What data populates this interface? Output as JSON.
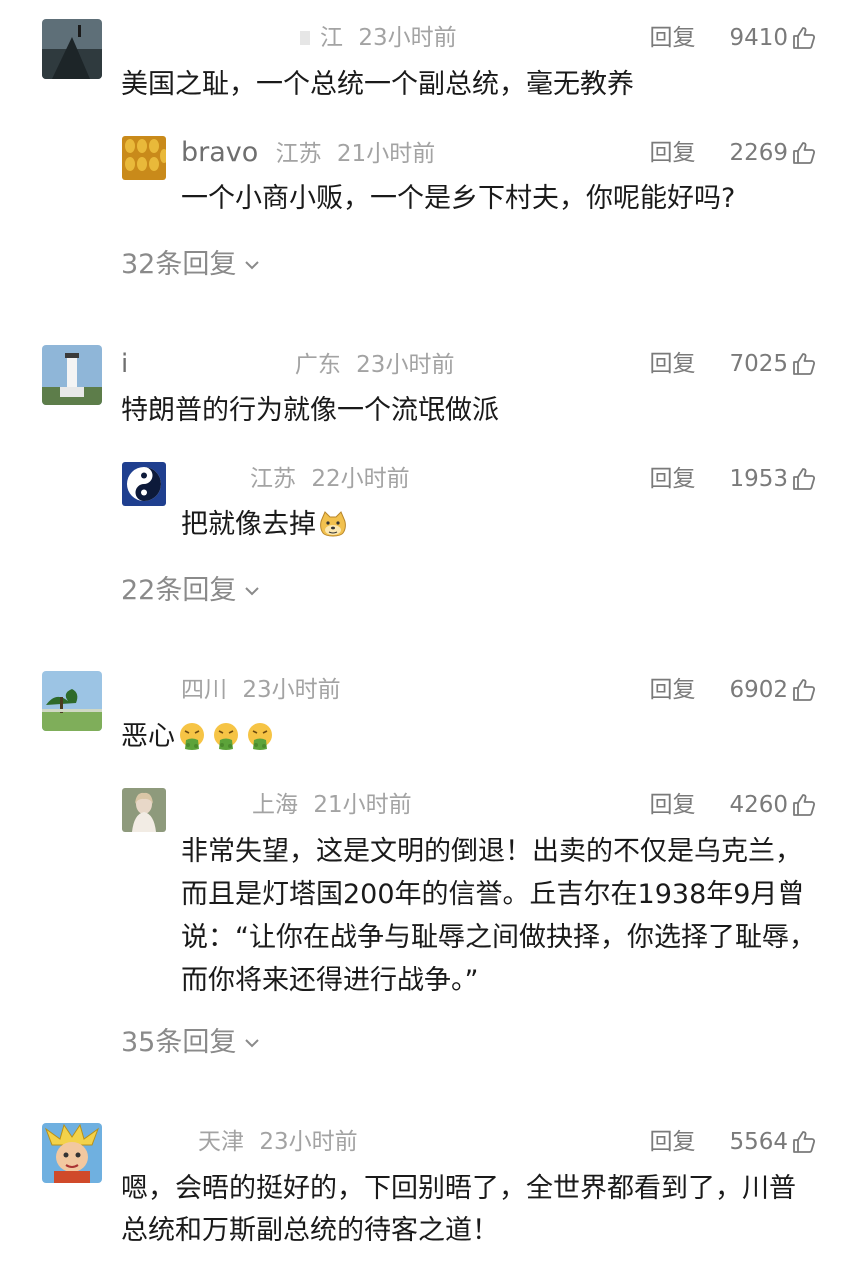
{
  "comments": [
    {
      "location": "江",
      "time": "23小时前",
      "reply_label": "回复",
      "likes": "9410",
      "text": "美国之耻，一个总统一个副总统，毫无教养",
      "reply": {
        "username": "bravo",
        "location": "江苏",
        "time": "21小时前",
        "reply_label": "回复",
        "likes": "2269",
        "text": "一个小商小贩，一个是乡下村夫，你呢能好吗?"
      },
      "more_replies": "32条回复"
    },
    {
      "name_fragment": "i",
      "location": "广东",
      "time": "23小时前",
      "reply_label": "回复",
      "likes": "7025",
      "text": "特朗普的行为就像一个流氓做派",
      "reply": {
        "location": "江苏",
        "time": "22小时前",
        "reply_label": "回复",
        "likes": "1953",
        "text": "把就像去掉"
      },
      "more_replies": "22条回复"
    },
    {
      "location": "四川",
      "time": "23小时前",
      "reply_label": "回复",
      "likes": "6902",
      "text": "恶心",
      "reply": {
        "location": "上海",
        "time": "21小时前",
        "reply_label": "回复",
        "likes": "4260",
        "text": "非常失望，这是文明的倒退！出卖的不仅是乌克兰，而且是灯塔国200年的信誉。丘吉尔在1938年9月曾说：“让你在战争与耻辱之间做抉择，你选择了耻辱，而你将来还得进行战争。”"
      },
      "more_replies": "35条回复"
    },
    {
      "location": "天津",
      "time": "23小时前",
      "reply_label": "回复",
      "likes": "5564",
      "text": "嗯，会晤的挺好的，下回别晤了，全世界都看到了，川普总统和万斯副总统的待客之道！"
    }
  ],
  "icons": {
    "like": "thumbs-up-outline",
    "expand": "chevron-down",
    "emoji_dog": "doge-face",
    "emoji_nauseated": "vomiting-face"
  },
  "colors": {
    "meta": "#a3a3a3",
    "action": "#7a7a7a",
    "text": "#1a1a1a",
    "more": "#8a8a8a"
  }
}
